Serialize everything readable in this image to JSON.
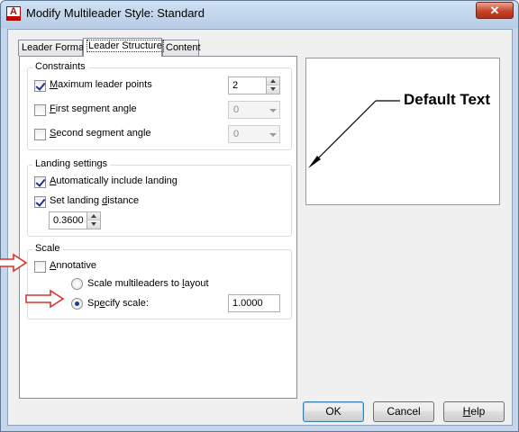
{
  "window": {
    "title": "Modify Multileader Style: Standard",
    "close_label": "✕"
  },
  "tabs": [
    {
      "label": "Leader Format",
      "active": false
    },
    {
      "label": "Leader Structure",
      "active": true
    },
    {
      "label": "Content",
      "active": false
    }
  ],
  "constraints": {
    "title": "Constraints",
    "max_points": {
      "checked": true,
      "pre": "",
      "key": "M",
      "rest": "aximum leader points",
      "value": "2"
    },
    "first_angle": {
      "checked": false,
      "pre": "",
      "key": "F",
      "rest": "irst segment angle",
      "value": "0"
    },
    "second_angle": {
      "checked": false,
      "pre": "",
      "key": "S",
      "rest": "econd segment angle",
      "value": "0"
    }
  },
  "landing": {
    "title": "Landing settings",
    "auto_include": {
      "checked": true,
      "pre": "",
      "key": "A",
      "rest": "utomatically include landing"
    },
    "set_distance": {
      "checked": true,
      "pre": "Set landing ",
      "key": "d",
      "rest": "istance"
    },
    "distance_value": "0.3600"
  },
  "scale": {
    "title": "Scale",
    "annotative": {
      "checked": false,
      "pre": "",
      "key": "A",
      "rest": "nnotative"
    },
    "to_layout": {
      "selected": false,
      "pre": "Scale multileaders to ",
      "key": "l",
      "rest": "ayout"
    },
    "specify": {
      "selected": true,
      "pre": "Sp",
      "key": "e",
      "rest": "cify scale:"
    },
    "scale_value": "1.0000"
  },
  "preview": {
    "text": "Default Text"
  },
  "buttons": {
    "ok": "OK",
    "cancel": "Cancel",
    "help_key": "H",
    "help_rest": "elp"
  },
  "colors": {
    "annotation_arrow": "#d9342b",
    "window_frame": "#c6d6ea"
  }
}
